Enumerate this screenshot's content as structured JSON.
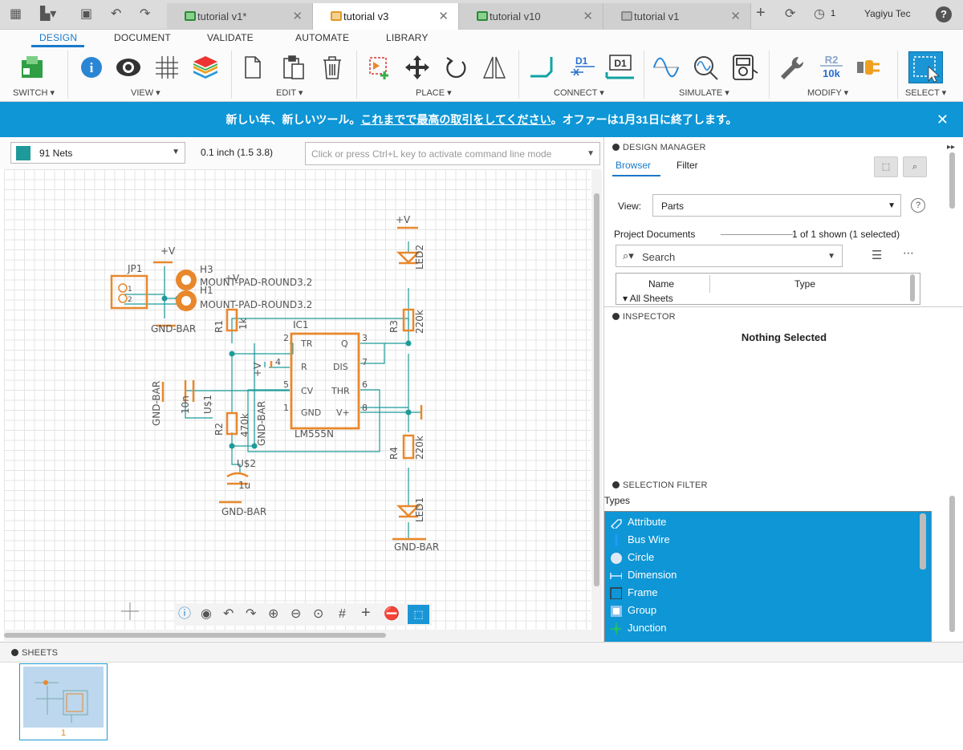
{
  "tabs": [
    {
      "label": "tutorial v1*"
    },
    {
      "label": "tutorial v3"
    },
    {
      "label": "tutorial v10"
    },
    {
      "label": "tutorial v1"
    }
  ],
  "topbar": {
    "notification_count": "1",
    "user_name": "Yagiyu Tec",
    "help": "?"
  },
  "ribbon": {
    "tabs": [
      "DESIGN",
      "DOCUMENT",
      "VALIDATE",
      "AUTOMATE",
      "LIBRARY"
    ],
    "groups": [
      "SWITCH ▾",
      "VIEW ▾",
      "EDIT ▾",
      "PLACE ▾",
      "CONNECT ▾",
      "SIMULATE ▾",
      "MODIFY ▾",
      "SELECT ▾"
    ],
    "icon_text": {
      "d1": "D1",
      "d1b": "D1",
      "r2": "R2",
      "val": "10k"
    }
  },
  "banner": {
    "pre": "新しい年、新しいツール。",
    "link": "これまでで最高の取引をしてください",
    "post": "。オファーは1月31日に終了します。",
    "close": "✕"
  },
  "canvasbar": {
    "nets": "91 Nets",
    "coordinate": "0.1 inch (1.5 3.8)",
    "cmd_placeholder": "Click or press Ctrl+L key to activate command line mode"
  },
  "schematic": {
    "labels": {
      "jp1": "JP1",
      "h3": "H3",
      "h1": "H1",
      "mount1": "MOUNT-PAD-ROUND3.2",
      "mount2": "MOUNT-PAD-ROUND3.2",
      "gnd1": "GND-BAR",
      "gnd2": "GND-BAR",
      "gnd3": "GND-BAR",
      "gnd4": "GND-BAR",
      "gnd5": "GND-BAR",
      "r1": "R1",
      "r1v": "1k",
      "r2": "R2",
      "r2v": "470k",
      "r3": "R3",
      "r3v": "220k",
      "r4": "R4",
      "r4v": "220k",
      "ic1": "IC1",
      "ic1v": "LM555N",
      "led1": "LED1",
      "led2": "LED2",
      "us1": "U$1",
      "us2": "U$2",
      "c1v": "10n",
      "c2v": "1u",
      "vplus1": "+V",
      "vplus2": "+V",
      "vplus3": "+V",
      "vplus4": "+V",
      "pin_tr": "TR",
      "pin_q": "Q",
      "pin_r": "R",
      "pin_dis": "DIS",
      "pin_cv": "CV",
      "pin_thr": "THR",
      "pin_gnd": "GND",
      "pin_vp": "V+",
      "n1": "1",
      "n2": "2",
      "n3": "3",
      "n4": "4",
      "n5": "5",
      "n6": "6",
      "n7": "7",
      "n8": "8",
      "jp_1": "1",
      "jp_2": "2"
    }
  },
  "design_manager": {
    "header": "DESIGN MANAGER",
    "tab_browser": "Browser",
    "tab_filter": "Filter",
    "view_label": "View:",
    "view_value": "Parts",
    "project_docs": "Project Documents",
    "shown": "1 of 1 shown (1 selected)",
    "search": "Search",
    "col_name": "Name",
    "col_type": "Type",
    "all_sheets": "All Sheets"
  },
  "inspector": {
    "header": "INSPECTOR",
    "nothing": "Nothing Selected"
  },
  "selection_filter": {
    "header": "SELECTION FILTER",
    "types_label": "Types",
    "items": [
      "Attribute",
      "Bus Wire",
      "Circle",
      "Dimension",
      "Frame",
      "Group",
      "Junction"
    ]
  },
  "sheets": {
    "header": "SHEETS",
    "page": "1"
  },
  "colors": {
    "accent": "#0e96d6",
    "part": "#e8882c",
    "wire": "#1f9a9a",
    "selection": "#1a79c9"
  }
}
